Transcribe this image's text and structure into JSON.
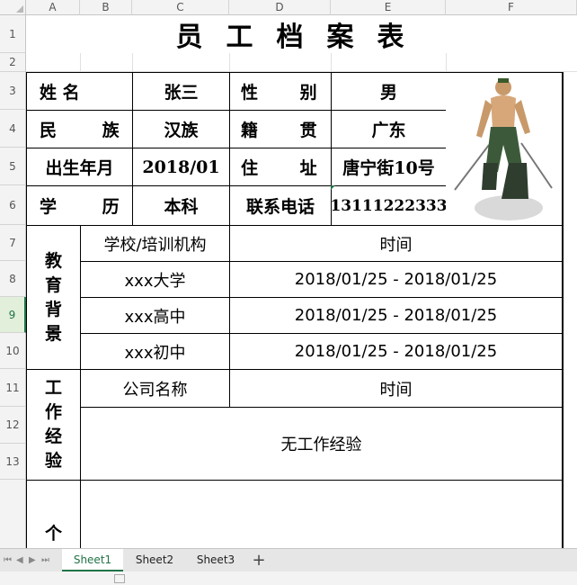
{
  "columns": [
    "A",
    "B",
    "C",
    "D",
    "E",
    "F"
  ],
  "rows": [
    "1",
    "2",
    "3",
    "4",
    "5",
    "6",
    "7",
    "8",
    "9",
    "10",
    "11",
    "12",
    "13"
  ],
  "selected_row": "9",
  "sheet": {
    "title": "员工档案表",
    "r3": {
      "name_label": "姓 名",
      "name_value": "张三",
      "gender_label": "性 别",
      "gender_value": "男"
    },
    "r4": {
      "ethnic_label": "民 族",
      "ethnic_value": "汉族",
      "origin_label": "籍 贯",
      "origin_value": "广东"
    },
    "r5": {
      "birth_label": "出生年月",
      "birth_value": "2018/01",
      "address_label": "住 址",
      "address_value": "唐宁街10号"
    },
    "r6": {
      "edu_label": "学 历",
      "edu_value": "本科",
      "phone_label": "联系电话",
      "phone_value": "13111222333"
    },
    "education": {
      "section_label": [
        "教",
        "育",
        "背",
        "景"
      ],
      "header_school": "学校/培训机构",
      "header_time": "时间",
      "rows": [
        {
          "school": "xxx大学",
          "time": "2018/01/25 - 2018/01/25"
        },
        {
          "school": "xxx高中",
          "time": "2018/01/25 - 2018/01/25"
        },
        {
          "school": "xxx初中",
          "time": "2018/01/25 - 2018/01/25"
        }
      ]
    },
    "work": {
      "section_label": [
        "工",
        "作",
        "经",
        "验"
      ],
      "header_company": "公司名称",
      "header_time": "时间",
      "note": "无工作经验"
    },
    "personal": {
      "section_label_partial": "个"
    }
  },
  "tabs": [
    "Sheet1",
    "Sheet2",
    "Sheet3"
  ],
  "add_sheet": "+",
  "photo_icon": "photo-icon",
  "colors": {
    "accent": "#217346"
  }
}
